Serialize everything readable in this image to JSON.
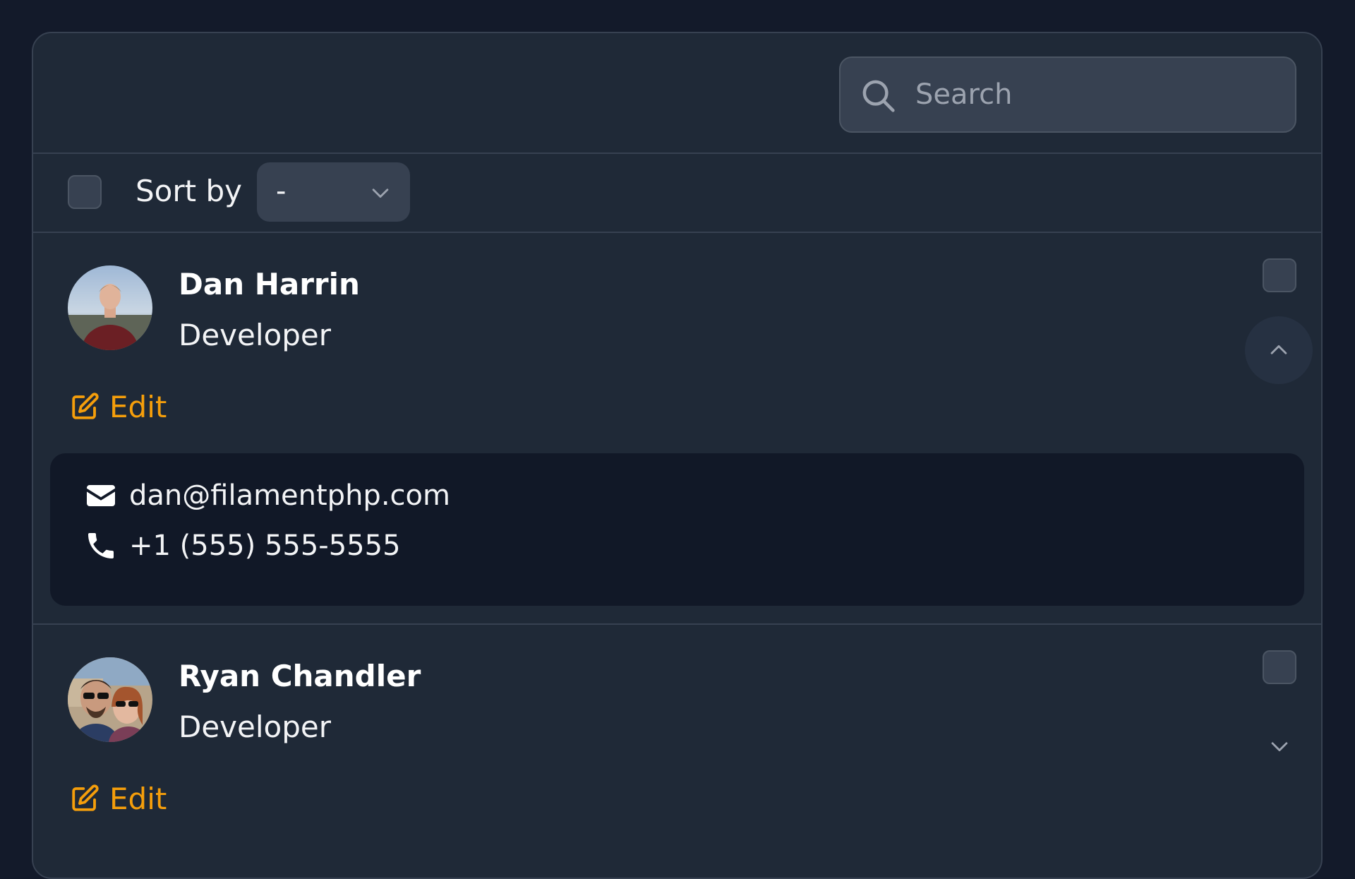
{
  "search": {
    "placeholder": "Search"
  },
  "toolbar": {
    "sort_label": "Sort by",
    "sort_value": "-"
  },
  "records": [
    {
      "name": "Dan Harrin",
      "role": "Developer",
      "edit_label": "Edit",
      "expanded": true,
      "email": "dan@filamentphp.com",
      "phone": "+1 (555) 555-5555"
    },
    {
      "name": "Ryan Chandler",
      "role": "Developer",
      "edit_label": "Edit",
      "expanded": false
    }
  ],
  "colors": {
    "background": "#131a2a",
    "panel": "#1f2937",
    "border": "#374151",
    "accent": "#f59e0b",
    "details_background": "#111827"
  }
}
